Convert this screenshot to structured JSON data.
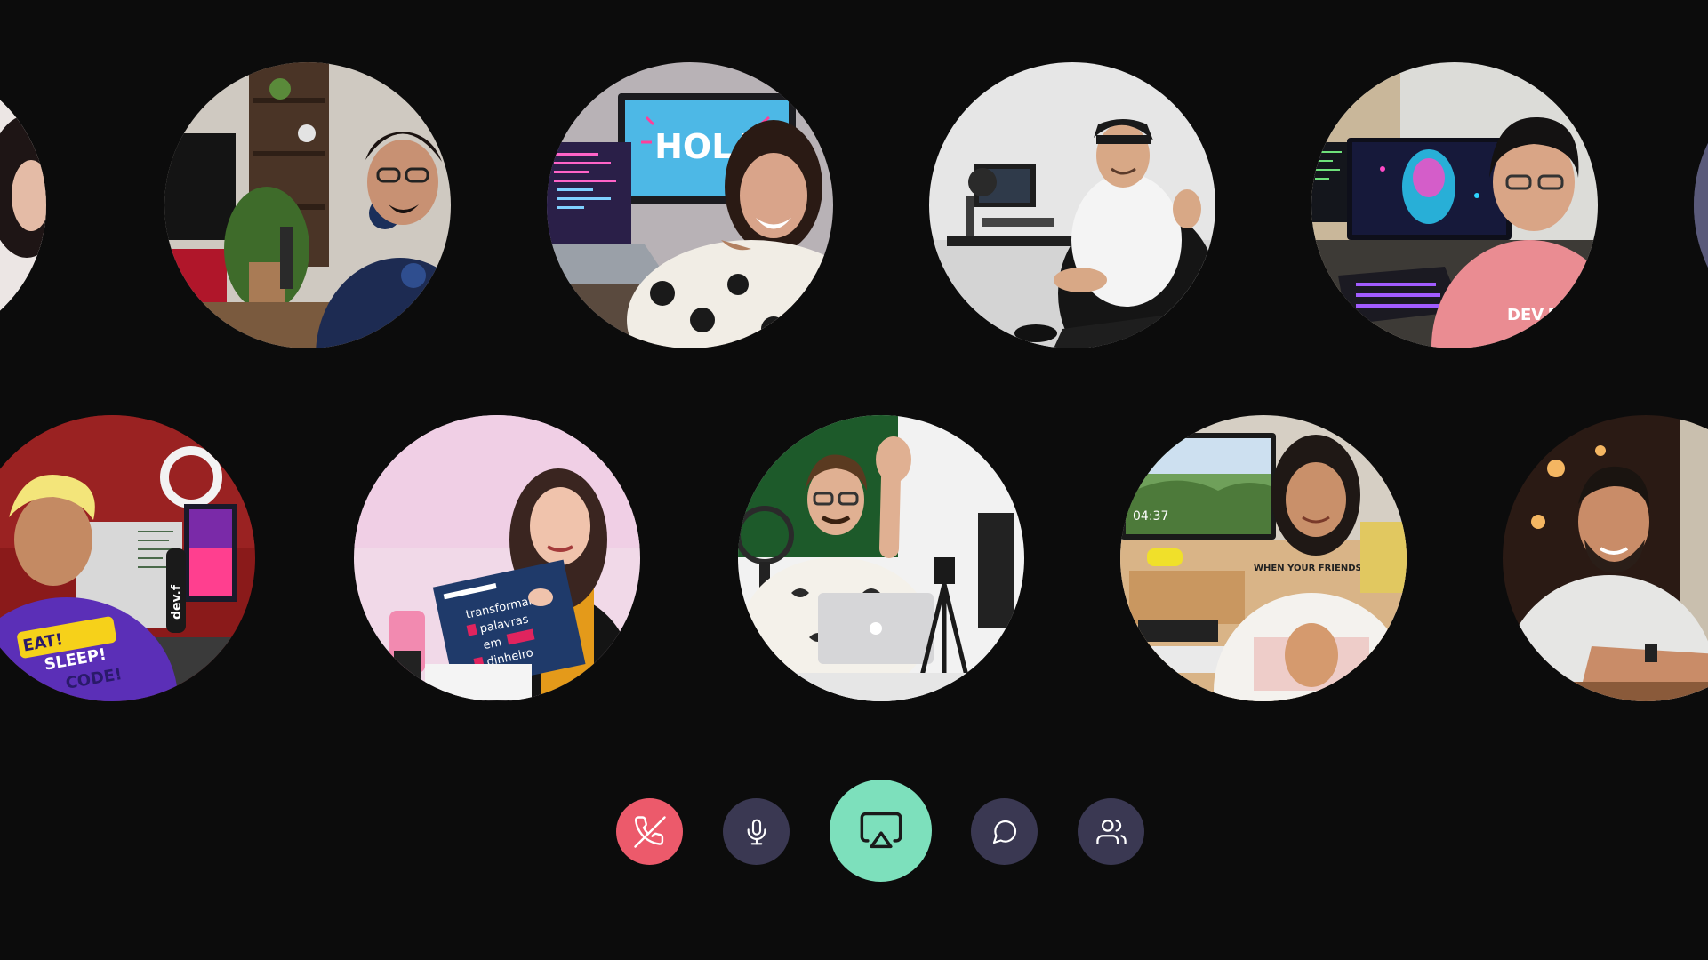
{
  "call": {
    "participants_grid": {
      "row_1": [
        "participant-0",
        "participant-1",
        "participant-2",
        "participant-3",
        "participant-4",
        "participant-5"
      ],
      "row_2": [
        "participant-6",
        "participant-7",
        "participant-8",
        "participant-9",
        "participant-10"
      ]
    },
    "screen_text": {
      "hola_monitor": "HOLA",
      "shirt_p4": "DEV.F",
      "shirt_p6_line1": "EAT!",
      "shirt_p6_line2": "SLEEP!",
      "shirt_p6_line3": "CODE!",
      "bottle_p6": "dev.f",
      "book_p7_line1": "transformando",
      "book_p7_line2": "palavras",
      "book_p7_line3": "em",
      "book_p7_line4": "dinheiro",
      "monitor_p9_clock": "04:37",
      "shirt_p9": "WHEN YOUR FRIENDS INSIST"
    }
  },
  "controls": {
    "end_call": {
      "icon": "phone-off-icon",
      "color": "#ec5a6b"
    },
    "microphone": {
      "icon": "mic-icon",
      "color": "#3a3852"
    },
    "share_screen": {
      "icon": "screen-share-icon",
      "color": "#7de0bc"
    },
    "chat": {
      "icon": "chat-bubble-icon",
      "color": "#3a3852"
    },
    "participants": {
      "icon": "people-icon",
      "color": "#3a3852"
    }
  },
  "theme": {
    "background": "#0c0c0c",
    "accent": "#7de0bc",
    "danger": "#ec5a6b",
    "control_bg": "#3a3852"
  }
}
